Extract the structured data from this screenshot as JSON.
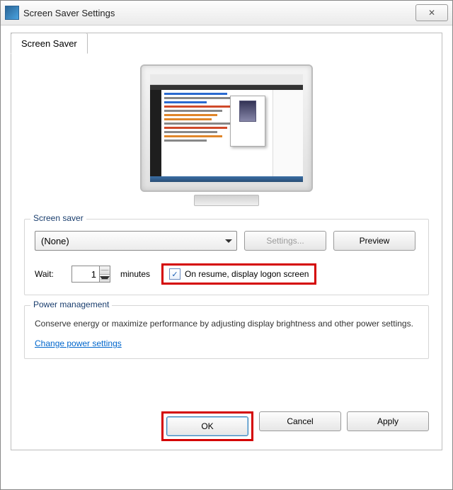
{
  "window": {
    "title": "Screen Saver Settings",
    "close_glyph": "✕"
  },
  "tab": {
    "label": "Screen Saver"
  },
  "screensaver_group": {
    "legend": "Screen saver",
    "dropdown_value": "(None)",
    "settings_btn": "Settings...",
    "preview_btn": "Preview",
    "wait_label": "Wait:",
    "wait_value": "1",
    "minutes_label": "minutes",
    "resume_checkbox_checked": "✓",
    "resume_label": "On resume, display logon screen"
  },
  "power_group": {
    "legend": "Power management",
    "description": "Conserve energy or maximize performance by adjusting display brightness and other power settings.",
    "link": "Change power settings"
  },
  "actions": {
    "ok": "OK",
    "cancel": "Cancel",
    "apply": "Apply"
  }
}
